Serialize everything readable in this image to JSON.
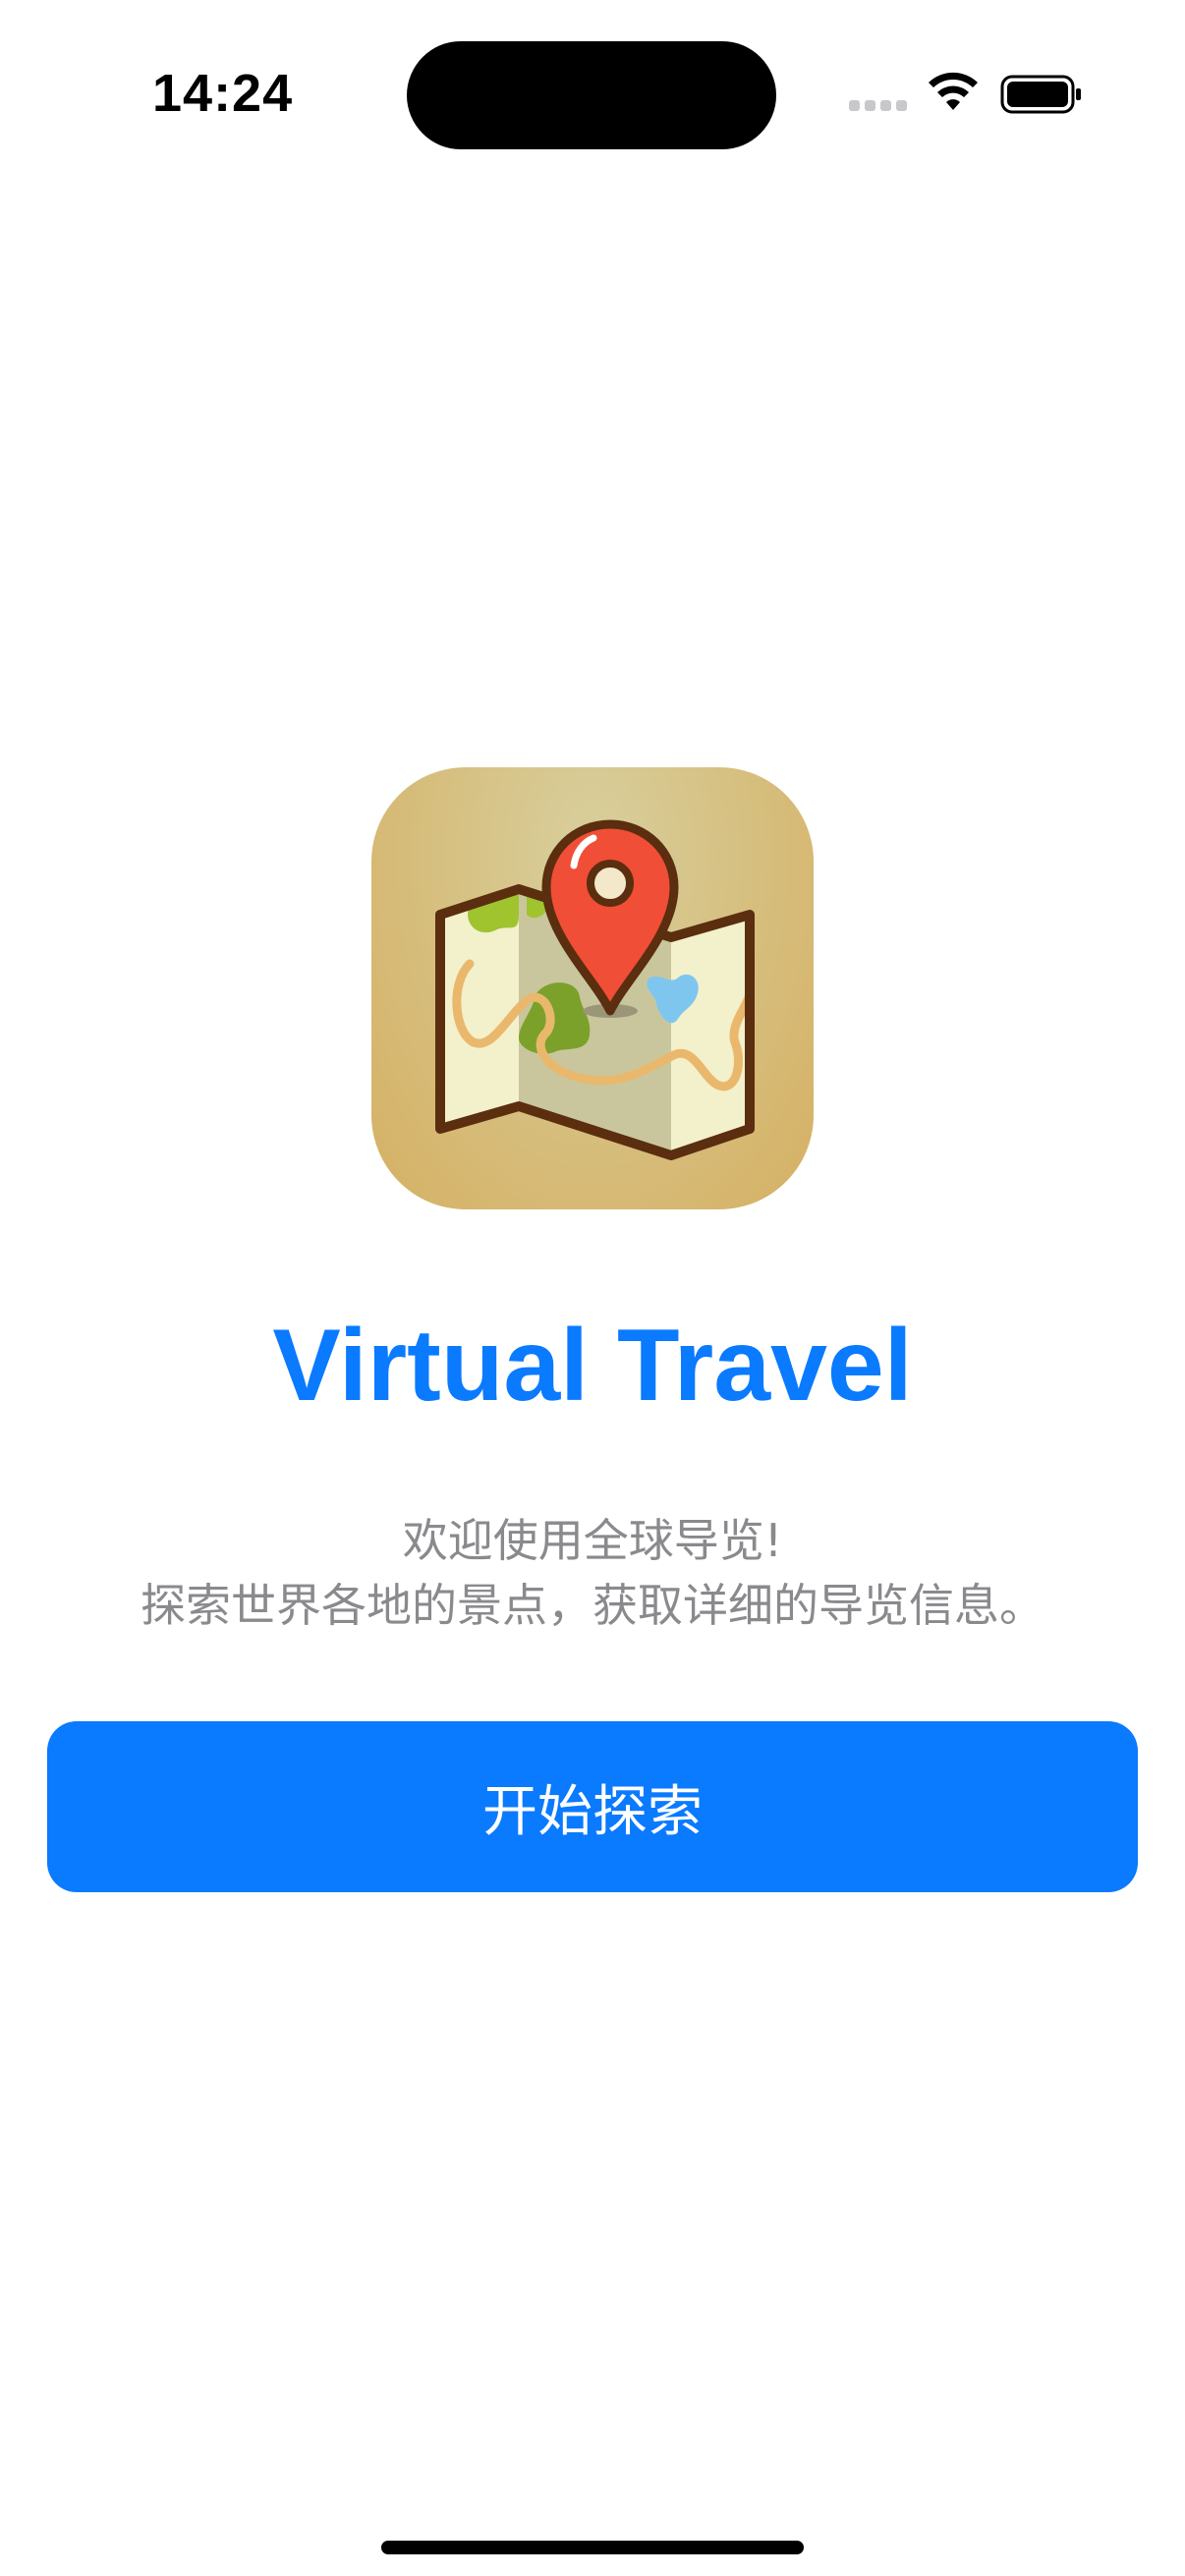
{
  "status_bar": {
    "time": "14:24",
    "icons": [
      "signal-dots-icon",
      "wifi-icon",
      "battery-icon"
    ]
  },
  "app_icon": {
    "icon": "folded-map-with-location-pin-icon"
  },
  "app": {
    "title": "Virtual Travel",
    "subtitle_line1": "欢迎使用全球导览!",
    "subtitle_line2": "探索世界各地的景点，获取详细的导览信息。",
    "start_button_label": "开始探索"
  },
  "colors": {
    "accent": "#0a7aff",
    "subtitle_text": "#8a8a8e",
    "pin": "#f04e37",
    "map_outline": "#5a2e0e"
  }
}
